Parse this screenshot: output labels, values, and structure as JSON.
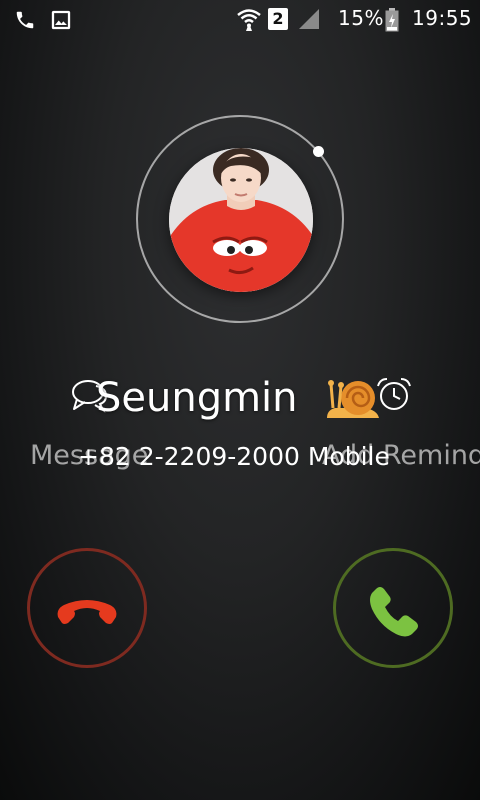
{
  "status_bar": {
    "icons": [
      "phone-icon",
      "gallery-icon",
      "wifi-icon",
      "sim-2-icon",
      "signal-icon",
      "battery-icon"
    ],
    "sim_slot": "2",
    "battery_percent": "15%",
    "time": "19:55"
  },
  "caller": {
    "name": "Seungmin",
    "emoji": "snail",
    "number": "+82 2-2209-2000 Mobile"
  },
  "actions": {
    "message_label": "Message",
    "reminder_label": "Add Reminder"
  },
  "buttons": {
    "decline_icon": "hang-up-icon",
    "answer_icon": "phone-answer-icon"
  },
  "colors": {
    "decline": "#e53a1e",
    "decline_ring": "#7e2a20",
    "answer": "#7cc241",
    "answer_ring": "#4e6b22"
  }
}
